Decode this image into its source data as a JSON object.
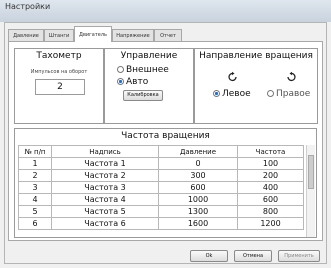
{
  "window": {
    "title": "Настройки"
  },
  "tabs": [
    {
      "label": "Давление",
      "active": false
    },
    {
      "label": "Штанги",
      "active": false
    },
    {
      "label": "Двигатель",
      "active": true
    },
    {
      "label": "Напряжение",
      "active": false
    },
    {
      "label": "Отчет",
      "active": false
    }
  ],
  "tachometer": {
    "title": "Тахометр",
    "pulses_label": "Импульсов на оборот",
    "pulses_value": "2"
  },
  "control": {
    "title": "Управление",
    "options": [
      {
        "label": "Внешнее",
        "selected": false
      },
      {
        "label": "Авто",
        "selected": true
      }
    ],
    "calibrate_label": "Калибровка"
  },
  "rotation": {
    "title": "Направление вращения",
    "left_label": "Левое",
    "right_label": "Правое",
    "selected": "left"
  },
  "frequency_table": {
    "title": "Частота вращения",
    "columns": [
      "№ п/п",
      "Надпись",
      "Давление",
      "Частота"
    ],
    "rows": [
      [
        "1",
        "Частота 1",
        "0",
        "100"
      ],
      [
        "2",
        "Частота 2",
        "300",
        "200"
      ],
      [
        "3",
        "Частота 3",
        "600",
        "400"
      ],
      [
        "4",
        "Частота 4",
        "1000",
        "600"
      ],
      [
        "5",
        "Частота 5",
        "1300",
        "800"
      ],
      [
        "6",
        "Частота 6",
        "1600",
        "1200"
      ]
    ]
  },
  "footer": {
    "ok_label": "Ok",
    "cancel_label": "Отмена",
    "apply_label": "Применить"
  }
}
